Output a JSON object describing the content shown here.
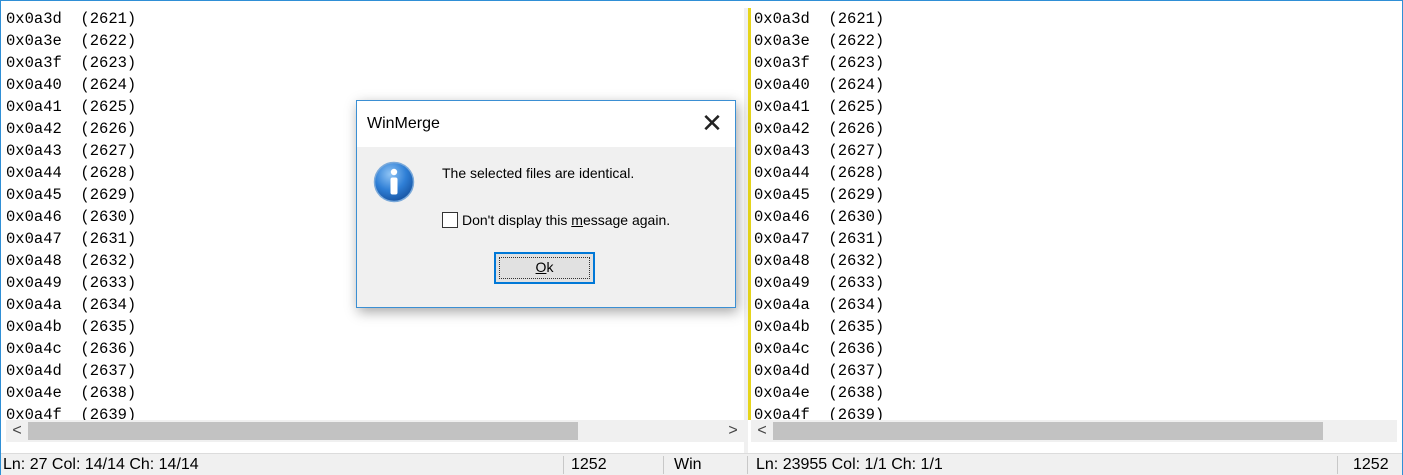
{
  "left_pane": {
    "lines": [
      "0x0a3d  (2621)",
      "0x0a3e  (2622)",
      "0x0a3f  (2623)",
      "0x0a40  (2624)",
      "0x0a41  (2625)",
      "0x0a42  (2626)",
      "0x0a43  (2627)",
      "0x0a44  (2628)",
      "0x0a45  (2629)",
      "0x0a46  (2630)",
      "0x0a47  (2631)",
      "0x0a48  (2632)",
      "0x0a49  (2633)",
      "0x0a4a  (2634)",
      "0x0a4b  (2635)",
      "0x0a4c  (2636)",
      "0x0a4d  (2637)",
      "0x0a4e  (2638)",
      "0x0a4f  (2639)"
    ]
  },
  "right_pane": {
    "lines": [
      "0x0a3d  (2621)",
      "0x0a3e  (2622)",
      "0x0a3f  (2623)",
      "0x0a40  (2624)",
      "0x0a41  (2625)",
      "0x0a42  (2626)",
      "0x0a43  (2627)",
      "0x0a44  (2628)",
      "0x0a45  (2629)",
      "0x0a46  (2630)",
      "0x0a47  (2631)",
      "0x0a48  (2632)",
      "0x0a49  (2633)",
      "0x0a4a  (2634)",
      "0x0a4b  (2635)",
      "0x0a4c  (2636)",
      "0x0a4d  (2637)",
      "0x0a4e  (2638)",
      "0x0a4f  (2639)"
    ]
  },
  "scrollbars": {
    "left_arrow": "<",
    "right_arrow": ">"
  },
  "statusbar": {
    "left_position": "Ln: 27  Col: 14/14  Ch: 14/14",
    "left_codepage": "1252",
    "left_eol": "Win",
    "right_position": "Ln: 23955  Col: 1/1  Ch: 1/1",
    "right_codepage": "1252"
  },
  "dialog": {
    "title": "WinMerge",
    "close_glyph": "✕",
    "message": "The selected files are identical.",
    "checkbox_pre": "Don't display this ",
    "checkbox_mnemonic": "m",
    "checkbox_post": "essage again.",
    "ok_mnemonic": "O",
    "ok_rest": "k",
    "icon": "info-icon"
  },
  "colors": {
    "frame_border": "#2f8fd6",
    "divider": "#e6d51a",
    "button_focus": "#0078d7"
  }
}
